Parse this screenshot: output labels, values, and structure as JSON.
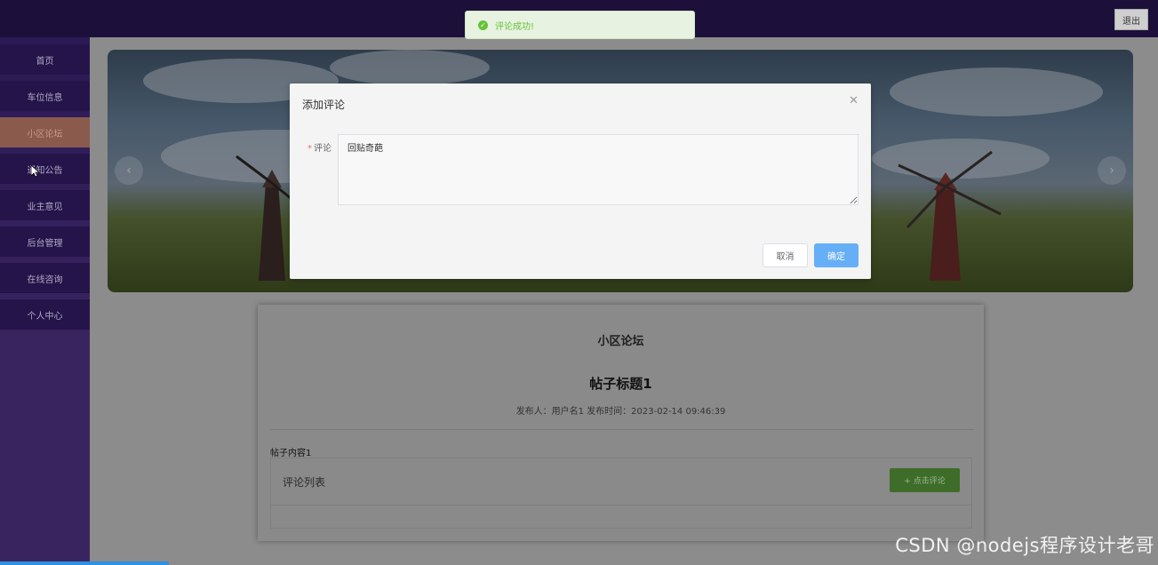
{
  "toast": {
    "message": "评论成功!",
    "icon": "check-circle-icon",
    "color": "#67c23a"
  },
  "header": {
    "logout_label": "退出"
  },
  "sidebar": {
    "items": [
      {
        "label": "首页"
      },
      {
        "label": "车位信息"
      },
      {
        "label": "小区论坛",
        "active": true
      },
      {
        "label": "通知公告"
      },
      {
        "label": "业主意见"
      },
      {
        "label": "后台管理"
      },
      {
        "label": "在线咨询"
      },
      {
        "label": "个人中心"
      }
    ]
  },
  "banner": {
    "prev_icon": "chevron-left-icon",
    "next_icon": "chevron-right-icon"
  },
  "forum": {
    "section_title": "小区论坛",
    "post_title": "帖子标题1",
    "meta": "发布人：用户名1  发布时间：2023-02-14 09:46:39",
    "content": "帖子内容1",
    "comments_title": "评论列表",
    "add_comment_label": "+ 点击评论"
  },
  "modal": {
    "title": "添加评论",
    "field_label": "评论",
    "field_value": "回贴奇葩",
    "cancel_label": "取消",
    "confirm_label": "确定"
  },
  "watermark": "CSDN @nodejs程序设计老哥",
  "colors": {
    "accent": "#66aff7",
    "success": "#67c23a",
    "sidebar_active": "#8a5a4c",
    "topbar": "#1c103a"
  }
}
